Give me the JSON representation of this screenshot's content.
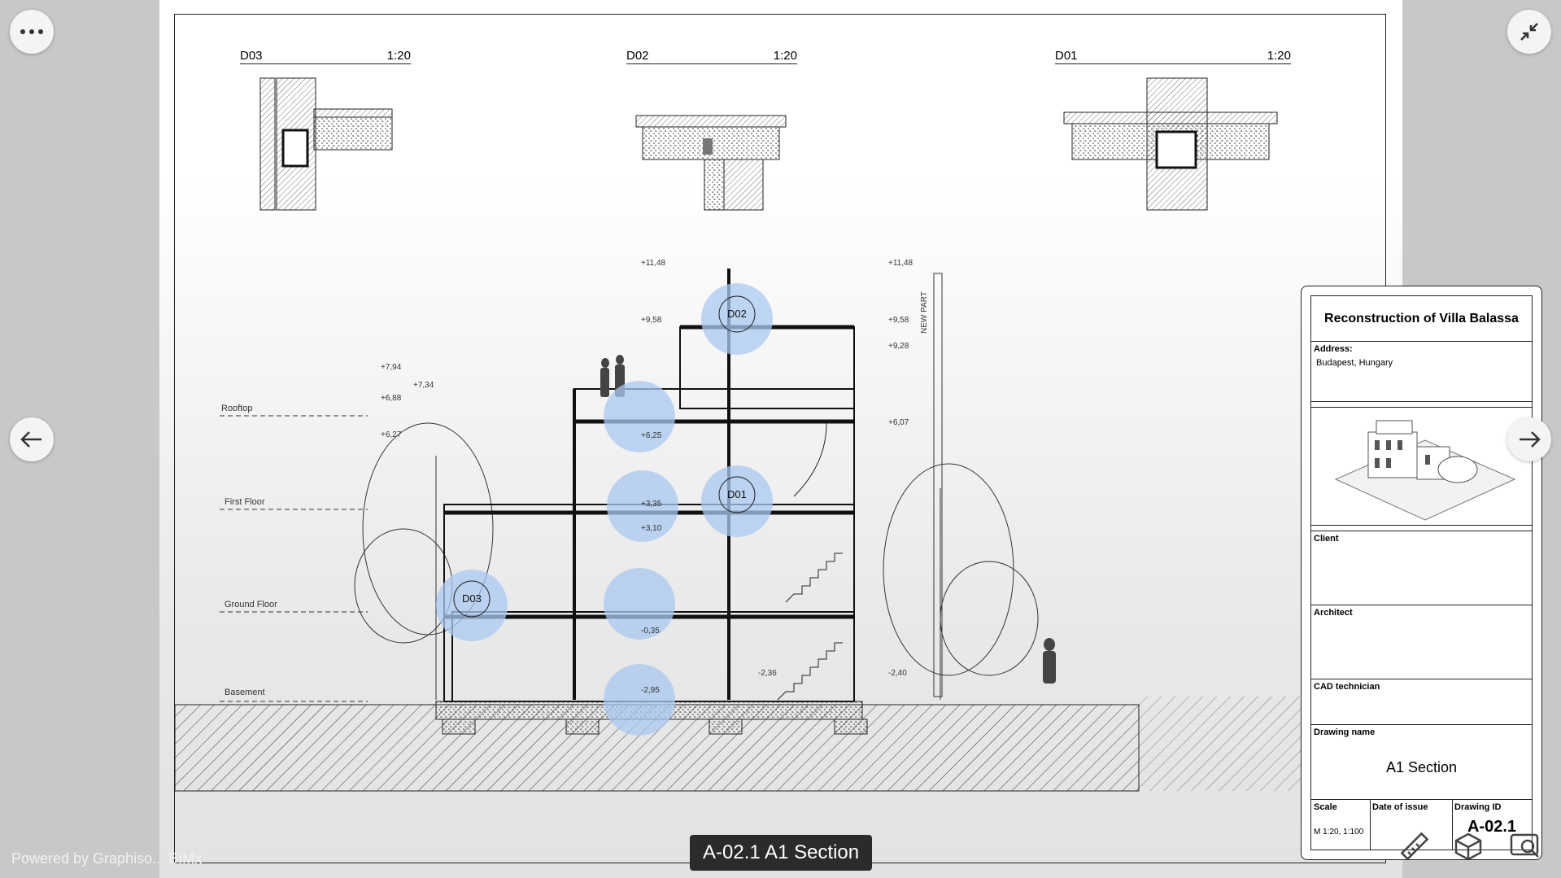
{
  "viewer": {
    "caption": "A-02.1 A1 Section",
    "powered_by": "Powered by Graphiso... BIMx",
    "colors": {
      "background": "#c8c8c8",
      "highlight": "#a9c9f0",
      "caption_bg": "#2b2b2b"
    }
  },
  "details": [
    {
      "id": "D03",
      "scale": "1:20"
    },
    {
      "id": "D02",
      "scale": "1:20"
    },
    {
      "id": "D01",
      "scale": "1:20"
    }
  ],
  "levels": {
    "rooftop": "Rooftop",
    "first_floor": "First Floor",
    "ground_floor": "Ground Floor",
    "basement": "Basement"
  },
  "elevations": [
    "+11,48",
    "+9,58",
    "+7,94",
    "+7,34",
    "+6,88",
    "+6,27",
    "+6,25",
    "+3,35",
    "+3,10",
    "-0,35",
    "-2,95",
    "+9,28",
    "+6,07",
    "-2,40",
    "-2,36"
  ],
  "markers": [
    "D02",
    "D01",
    "D03"
  ],
  "vertical_label": "NEW PART",
  "title_block": {
    "project": "Reconstruction of Villa Balassa",
    "address_label": "Address:",
    "address": "Budapest, Hungary",
    "client_label": "Client",
    "architect_label": "Architect",
    "cad_label": "CAD technician",
    "drawing_name_label": "Drawing name",
    "drawing_name": "A1 Section",
    "scale_label": "Scale",
    "scale": "M 1:20, 1:100",
    "date_label": "Date of issue",
    "id_label": "Drawing ID",
    "drawing_id": "A-02.1"
  },
  "icons": [
    "more-icon",
    "collapse-icon",
    "arrow-left-icon",
    "arrow-right-icon",
    "ruler-icon",
    "cube-icon",
    "zoom-screen-icon"
  ]
}
